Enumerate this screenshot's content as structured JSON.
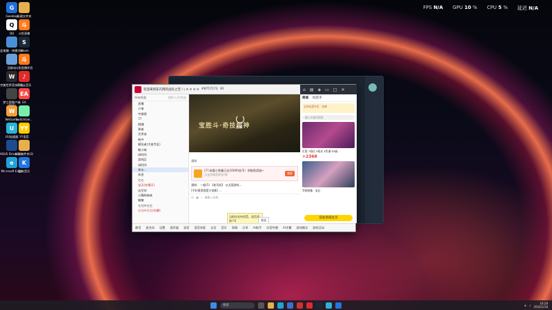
{
  "perf": {
    "fps_label": "FPS",
    "fps_value": "N/A",
    "gpu_label": "GPU",
    "gpu_value": "10",
    "cpu_label": "CPU",
    "cpu_value": "5",
    "latency_label": "延迟",
    "latency_value": "N/A"
  },
  "desktop_icons": [
    {
      "label": "Geekbip",
      "color": "#1e6fd9",
      "glyph": "G"
    },
    {
      "label": "新建文件夹",
      "color": "#e8b04a",
      "glyph": ""
    },
    {
      "label": "QQ",
      "color": "#ffffff",
      "glyph": "Q"
    },
    {
      "label": "斗鱼直播",
      "color": "#ff7a1a",
      "glyph": "斗"
    },
    {
      "label": "此电脑 · 快捷方式",
      "color": "#4a90d9",
      "glyph": ""
    },
    {
      "label": "Steam",
      "color": "#1b2838",
      "glyph": "S"
    },
    {
      "label": "回收站",
      "color": "#6aa0d8",
      "glyph": ""
    },
    {
      "label": "斗鱼直播伴侣",
      "color": "#ff7a1a",
      "glyph": "斗"
    },
    {
      "label": "完美世界竞技平台",
      "color": "#2b2b2b",
      "glyph": "W"
    },
    {
      "label": "网易云音乐",
      "color": "#e02b2b",
      "glyph": "♪"
    },
    {
      "label": "梦三国客户端 (PMF)",
      "color": "#444",
      "glyph": ""
    },
    {
      "label": "EA",
      "color": "#ff4747",
      "glyph": "EA"
    },
    {
      "label": "WeGame",
      "color": "#f2a03a",
      "glyph": "W"
    },
    {
      "label": "SwitchGer...",
      "color": "#7ea",
      "glyph": ""
    },
    {
      "label": "UU加速器",
      "color": "#29b4d8",
      "glyph": "U"
    },
    {
      "label": "YY语音",
      "color": "#ffcc00",
      "glyph": "YY"
    },
    {
      "label": "ASUS DriverHub",
      "color": "#1e4b8f",
      "glyph": ""
    },
    {
      "label": "新建文件夹(2)",
      "color": "#e8b04a",
      "glyph": ""
    },
    {
      "label": "Microsoft Edge",
      "color": "#1fa3d6",
      "glyph": "e"
    },
    {
      "label": "酷狗音乐",
      "color": "#2277dd",
      "glyph": "K"
    }
  ],
  "window": {
    "title": "欢迎来到非凡网的战队之音 \\ \\ ≋ ≋ ≋ ≋",
    "room_id": "#8757173",
    "users": "30",
    "shop_tab": "商城",
    "shop_tab2": "抖店子"
  },
  "channel_list": {
    "toolbar": "所有频道",
    "placeholder": "搜索人员/频道",
    "items": [
      "直播",
      "小电",
      "宇樂馆",
      "77",
      "棋鋪",
      "勇者",
      "艾伊迪",
      "新卉",
      "模仿者(大佬专区)",
      "敏小碗",
      "闲时间",
      "游戏区",
      "闲时间",
      "茶水...",
      "休息",
      "七七",
      "宝天(在聊天)",
      "去艾你",
      "小舞刷妹妹",
      "擁擁",
      "七七叶七七",
      "七七叶七七(在聊)"
    ]
  },
  "video": {
    "status": "直播",
    "overlay": "宝胜斗·奇技超神"
  },
  "chat": {
    "header": "通知",
    "gift_text": "[7] 恭喜小鱼童已达10000金币！领取鱼奖励~",
    "gift_sub": "点击领取您的礼物",
    "gift_button": "领奖",
    "line1": "通知：  一般(5)  【老司机】 以太国游戏...",
    "line2": "[不好意思我是大电影] ... ",
    "input_placeholder": "请输入消息...",
    "tooltip": "当前仅支持语音，说话请按 F6",
    "send": "发送"
  },
  "shop": {
    "tab1": "商城",
    "tab2": "抖店子",
    "banner": "全场优惠专区 · 包邮",
    "search_placeholder": "输入关键词搜索",
    "card1_title": "灯笼 7档位 5档光 4色谱 83级...",
    "card1_price": "+2368",
    "card2_title": "华丽装备 · 宝石",
    "go_button": "前往商城主页"
  },
  "bottombar": {
    "items": [
      "静音",
      "麦克风",
      "设置",
      "扬声器",
      "录音",
      "语音排麦",
      "全员",
      "音乐",
      "表情",
      "分享",
      "AI助手",
      "抖音传播",
      "AI字幕",
      "游戏模式",
      "游戏活动"
    ]
  },
  "taskbar": {
    "search": "搜索",
    "time": "16:28",
    "date": "2024/1/18"
  }
}
